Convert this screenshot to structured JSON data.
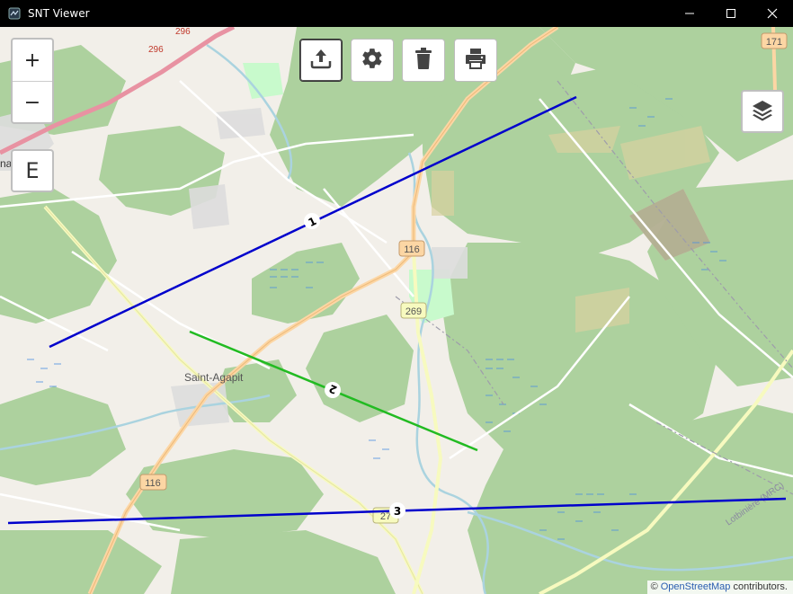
{
  "window": {
    "title": "SNT Viewer"
  },
  "zoom": {
    "in": "+",
    "out": "−"
  },
  "e_button": "E",
  "toolbar": [
    {
      "name": "upload-icon"
    },
    {
      "name": "gear-icon"
    },
    {
      "name": "trash-icon"
    },
    {
      "name": "printer-icon"
    }
  ],
  "map": {
    "roads": [
      {
        "label": "116",
        "where": "center-north"
      },
      {
        "label": "269",
        "where": "center"
      },
      {
        "label": "116",
        "where": "south-west"
      },
      {
        "label": "27",
        "where": "south"
      },
      {
        "label": "171",
        "where": "north-east"
      },
      {
        "label": "296",
        "where": "north-west"
      },
      {
        "label": "296",
        "where": "north-west"
      }
    ],
    "town": "Saint-Agapit",
    "region_label": "Lotbinière (MRC)",
    "left_edge_text": "na"
  },
  "profiles": [
    {
      "label": "1",
      "color": "#0000cc"
    },
    {
      "label": "2",
      "color": "#22bb22"
    },
    {
      "label": "3",
      "color": "#0000cc"
    }
  ],
  "attribution": {
    "prefix": "© ",
    "link": "OpenStreetMap",
    "suffix": " contributors."
  }
}
